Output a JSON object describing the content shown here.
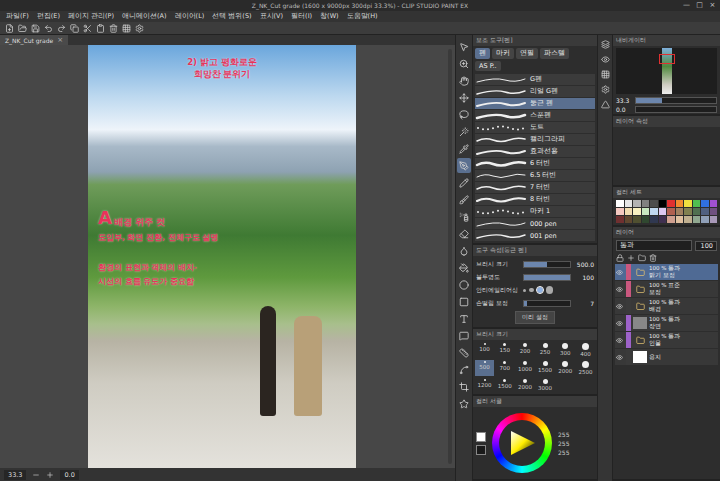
{
  "window": {
    "title": "Z_NK_Cut grade (1600 x 9000px 300dpi 33.3%) - CLIP STUDIO PAINT EX",
    "controls": [
      "—",
      "□",
      "×"
    ]
  },
  "menu": [
    "파일(F)",
    "편집(E)",
    "페이지 관리(P)",
    "애니메이션(A)",
    "레이어(L)",
    "선택 범위(S)",
    "표시(V)",
    "필터(I)",
    "창(W)",
    "도움말(H)"
  ],
  "document_tab": {
    "label": "Z_NK_Cut grade",
    "close": "×",
    "selected": true
  },
  "canvas": {
    "annotations": [
      {
        "text": "2) 밝고 평화로운",
        "kind": "title"
      },
      {
        "text": "희망찬 분위기",
        "kind": "title"
      },
      {
        "text": "A",
        "kind": "mark"
      },
      {
        "text": "배경 위주 컷",
        "kind": "heading"
      },
      {
        "text": "도입부, 화면 전환, 전체구도 설명",
        "kind": "note"
      },
      {
        "text": "환경의 표현과 객체의 배치-",
        "kind": "note"
      },
      {
        "text": "시선의 흐름 유도가 중요함",
        "kind": "note"
      }
    ]
  },
  "status_bar": {
    "zoom": "33.3",
    "angle": "0.0"
  },
  "tools": [
    {
      "selected": false
    },
    {
      "selected": false
    },
    {
      "selected": false
    },
    {
      "selected": false
    },
    {
      "selected": false
    },
    {
      "selected": false
    },
    {
      "selected": false
    },
    {
      "selected": true
    },
    {
      "selected": false
    },
    {
      "selected": false
    },
    {
      "selected": false
    },
    {
      "selected": false
    },
    {
      "selected": false
    },
    {
      "selected": false
    },
    {
      "selected": false
    },
    {
      "selected": false
    },
    {
      "selected": false
    },
    {
      "selected": false
    },
    {
      "selected": false
    },
    {
      "selected": false
    },
    {
      "selected": false
    },
    {
      "selected": false
    }
  ],
  "sub_tool": {
    "header": "보조 도구[펜]",
    "groups": [
      {
        "label": "펜",
        "selected": true
      },
      {
        "label": "마커",
        "selected": false
      },
      {
        "label": "연필",
        "selected": false
      },
      {
        "label": "파스텔",
        "selected": false
      },
      {
        "label": "AS P..",
        "selected": false
      }
    ],
    "items": [
      {
        "name": "G펜",
        "kind": "line",
        "selected": false
      },
      {
        "name": "리얼 G펜",
        "kind": "line",
        "selected": false
      },
      {
        "name": "둥근 펜",
        "kind": "line",
        "selected": true
      },
      {
        "name": "스푼펜",
        "kind": "line",
        "selected": false
      },
      {
        "name": "도트",
        "kind": "dots",
        "selected": false
      },
      {
        "name": "캘리그라피",
        "kind": "wave",
        "selected": false
      },
      {
        "name": "효과선용",
        "kind": "line",
        "selected": false
      },
      {
        "name": "6 터빈",
        "kind": "wave",
        "selected": false
      },
      {
        "name": "6.5 터빈",
        "kind": "wave",
        "selected": false
      },
      {
        "name": "7 터빈",
        "kind": "wave",
        "selected": false
      },
      {
        "name": "8 터빈",
        "kind": "wave",
        "selected": false
      },
      {
        "name": "마커 1",
        "kind": "dots",
        "selected": false
      },
      {
        "name": "000 pen",
        "kind": "line",
        "selected": false
      },
      {
        "name": "001 pen",
        "kind": "line",
        "selected": false
      }
    ]
  },
  "tool_property": {
    "header": "도구 속성[둥근 펜]",
    "rows": [
      {
        "label": "브러시 크기",
        "value": "500.0",
        "level": 0.5,
        "kind": "slider"
      },
      {
        "label": "불투명도",
        "value": "100",
        "level": 1,
        "kind": "slider"
      },
      {
        "label": "안티에일리어싱",
        "kind": "choice",
        "options": [
          {
            "selected": false
          },
          {
            "selected": false
          },
          {
            "selected": true
          },
          {
            "selected": false
          }
        ]
      },
      {
        "label": "손떨림 보정",
        "value": "7",
        "level": 0.07,
        "kind": "slider"
      }
    ],
    "button": "미리 설정"
  },
  "brush_size": {
    "header": "브러시 크기",
    "sizes": [
      {
        "value": "100",
        "selected": false
      },
      {
        "value": "150",
        "selected": false
      },
      {
        "value": "200",
        "selected": false
      },
      {
        "value": "250",
        "selected": false
      },
      {
        "value": "300",
        "selected": false
      },
      {
        "value": "400",
        "selected": false
      },
      {
        "value": "500",
        "selected": true
      },
      {
        "value": "700",
        "selected": false
      },
      {
        "value": "1000",
        "selected": false
      },
      {
        "value": "1500",
        "selected": false
      },
      {
        "value": "2000",
        "selected": false
      },
      {
        "value": "2500",
        "selected": false
      },
      {
        "value": "1200",
        "selected": false
      },
      {
        "value": "1500",
        "selected": false
      },
      {
        "value": "2000",
        "selected": false
      },
      {
        "value": "3000",
        "selected": false
      }
    ]
  },
  "color_wheel": {
    "header": "컬러 서클",
    "values": [
      "255",
      "255",
      "255"
    ]
  },
  "navigator": {
    "header": "내비게이터",
    "zoom": "33.3",
    "angle": "0.0",
    "zoom_level": 0.33
  },
  "layer_property": {
    "header": "레이어 속성"
  },
  "color_set": {
    "header": "컬러 세트",
    "swatches": [
      {
        "color": "#ffffff"
      },
      {
        "color": "#e6e6e6"
      },
      {
        "color": "#b3b3b3"
      },
      {
        "color": "#808080"
      },
      {
        "color": "#4d4d4d"
      },
      {
        "color": "#000000"
      },
      {
        "color": "#e03030"
      },
      {
        "color": "#f08a30"
      },
      {
        "color": "#f0e040"
      },
      {
        "color": "#50c050"
      },
      {
        "color": "#3070e0"
      },
      {
        "color": "#a050d0"
      },
      {
        "color": "#f4c8c0"
      },
      {
        "color": "#f0dcb0"
      },
      {
        "color": "#f8f0c0"
      },
      {
        "color": "#c8e8c0"
      },
      {
        "color": "#c0d8f0"
      },
      {
        "color": "#dcc8f0"
      },
      {
        "color": "#b06050"
      },
      {
        "color": "#a08060"
      },
      {
        "color": "#808050"
      },
      {
        "color": "#507050"
      },
      {
        "color": "#506080"
      },
      {
        "color": "#705080"
      },
      {
        "color": "#703030"
      },
      {
        "color": "#604830"
      },
      {
        "color": "#505030"
      },
      {
        "color": "#304830"
      },
      {
        "color": "#303850"
      },
      {
        "color": "#403050"
      },
      {
        "color": "#d0a090"
      },
      {
        "color": "#e0c0a0"
      },
      {
        "color": "#c0b090"
      },
      {
        "color": "#90a890"
      },
      {
        "color": "#90a0b8"
      },
      {
        "color": "#a898b8"
      }
    ]
  },
  "layers": {
    "header": "레이어",
    "blend": "통과",
    "opacity": "100",
    "items": [
      {
        "opacity": "100 % 통과",
        "name": "밝기 보정",
        "selected": true,
        "visible": true,
        "color": "#c9577e",
        "kind": "folder"
      },
      {
        "opacity": "100 % 표준",
        "name": "보정",
        "selected": false,
        "visible": true,
        "color": "#c9577e",
        "kind": "folder"
      },
      {
        "opacity": "100 % 통과",
        "name": "배경",
        "selected": false,
        "visible": true,
        "color": "#3a3a3a",
        "kind": "folder"
      },
      {
        "opacity": "100 % 통과",
        "name": "장면",
        "selected": false,
        "visible": true,
        "color": "#9d62c9",
        "kind": "layer"
      },
      {
        "opacity": "100 % 통과",
        "name": "인물",
        "selected": false,
        "visible": true,
        "color": "#9d62c9",
        "kind": "folder"
      },
      {
        "opacity": "",
        "name": "용지",
        "selected": false,
        "visible": true,
        "color": "#3a3a3a",
        "kind": "paper"
      }
    ]
  }
}
